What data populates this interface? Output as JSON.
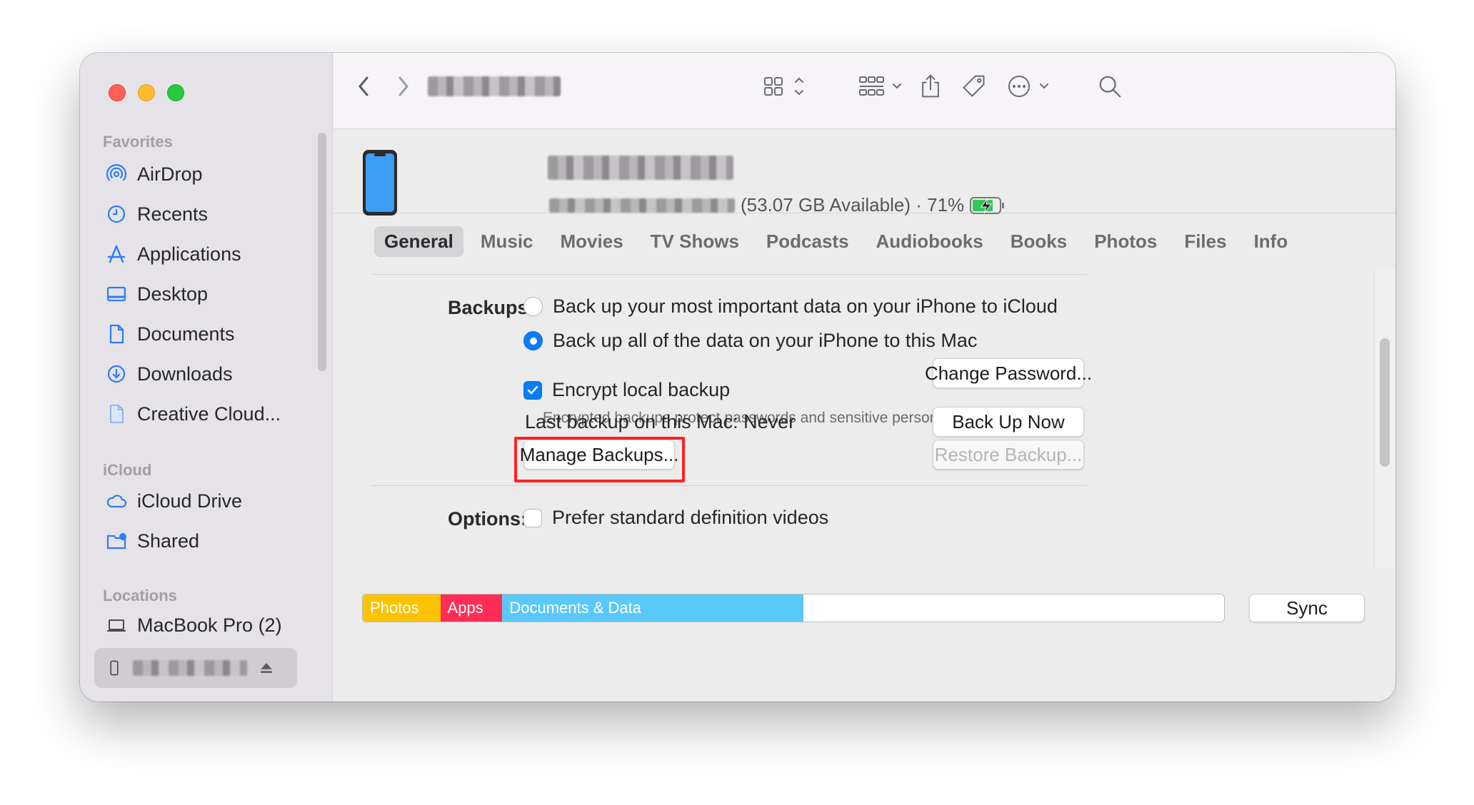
{
  "sidebar": {
    "sections": {
      "favorites": "Favorites",
      "icloud": "iCloud",
      "locations": "Locations"
    },
    "favorites": [
      {
        "label": "AirDrop",
        "icon": "airdrop-icon"
      },
      {
        "label": "Recents",
        "icon": "clock-icon"
      },
      {
        "label": "Applications",
        "icon": "applications-icon"
      },
      {
        "label": "Desktop",
        "icon": "desktop-icon"
      },
      {
        "label": "Documents",
        "icon": "document-icon"
      },
      {
        "label": "Downloads",
        "icon": "download-icon"
      },
      {
        "label": "Creative Cloud...",
        "icon": "file-icon"
      }
    ],
    "icloud": [
      {
        "label": "iCloud Drive",
        "icon": "cloud-icon"
      },
      {
        "label": "Shared",
        "icon": "shared-folder-icon"
      }
    ],
    "locations": [
      {
        "label": "MacBook Pro (2)",
        "icon": "laptop-icon"
      }
    ]
  },
  "device": {
    "status": "(53.07 GB Available) · 71%",
    "battery_percent": 71
  },
  "tabs": [
    "General",
    "Music",
    "Movies",
    "TV Shows",
    "Podcasts",
    "Audiobooks",
    "Books",
    "Photos",
    "Files",
    "Info"
  ],
  "active_tab": "General",
  "backups": {
    "label": "Backups:",
    "option_icloud": "Back up your most important data on your iPhone to iCloud",
    "option_mac": "Back up all of the data on your iPhone to this Mac",
    "selected": "mac",
    "encrypt_label": "Encrypt local backup",
    "encrypt_checked": true,
    "encrypt_note": "Encrypted backups protect passwords and sensitive personal data.",
    "change_password": "Change Password...",
    "last_backup": "Last backup on this Mac:  Never",
    "back_up_now": "Back Up Now",
    "manage_backups": "Manage Backups...",
    "restore_backup": "Restore Backup..."
  },
  "options": {
    "label": "Options:",
    "prefer_sd": "Prefer standard definition videos"
  },
  "storage": {
    "segments": [
      {
        "label": "Photos",
        "color": "#fdc300",
        "fraction": 0.09
      },
      {
        "label": "Apps",
        "color": "#ff2d55",
        "fraction": 0.072
      },
      {
        "label": "Documents & Data",
        "color": "#5ac8fa",
        "fraction": 0.35
      }
    ]
  },
  "sync_label": "Sync",
  "colors": {
    "accent": "#0a7cf9",
    "highlight_box": "#ff2222"
  }
}
